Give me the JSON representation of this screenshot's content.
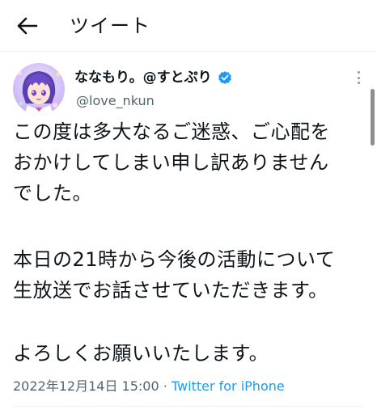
{
  "header": {
    "title": "ツイート",
    "back_icon": "arrow-left-icon"
  },
  "author": {
    "display_name": "ななもり。@すとぷり",
    "handle": "@love_nkun",
    "verified": true,
    "verified_icon": "verified-badge-icon",
    "verified_color": "#1d9bf0"
  },
  "more_icon": "more-vertical-icon",
  "tweet": {
    "lines": [
      "この度は多大なるご迷惑、ご心配を",
      "おかけしてしまい申し訳ありません",
      "でした。",
      "本日の21時から今後の活動について",
      "生放送でお話させていただきます。",
      "よろしくお願いいたします。"
    ]
  },
  "meta": {
    "datetime": "2022年12月14日 15:00",
    "separator": " · ",
    "source": "Twitter for iPhone"
  },
  "colors": {
    "text": "#0f1419",
    "secondary": "#536471",
    "accent": "#1d9bf0"
  }
}
